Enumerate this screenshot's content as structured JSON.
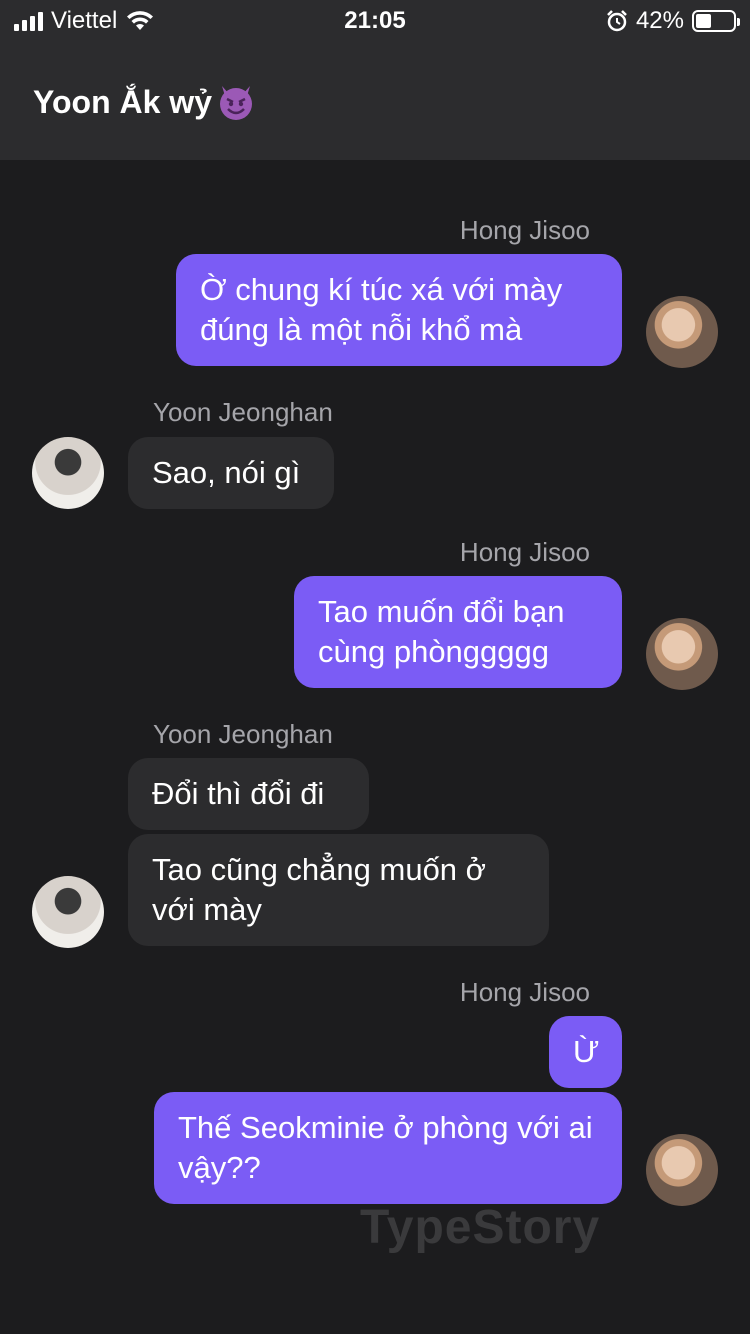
{
  "status_bar": {
    "carrier": "Viettel",
    "time": "21:05",
    "battery": "42%",
    "battery_level": 0.42
  },
  "header": {
    "title": "Yoon Ắk wỷ",
    "icon": "devil-emoji-icon"
  },
  "messages": [
    {
      "sender": "Hong Jisoo",
      "text": "Ờ chung kí túc xá với mày đúng là một nỗi khổ mà"
    },
    {
      "sender": "Yoon Jeonghan",
      "text": "Sao, nói gì"
    },
    {
      "sender": "Hong Jisoo",
      "text": "Tao muốn đổi bạn cùng phònggggg"
    },
    {
      "sender": "Yoon Jeonghan",
      "text": "Đổi thì đổi đi"
    },
    {
      "sender": "Yoon Jeonghan",
      "text": "Tao cũng chẳng muốn ở với mày"
    },
    {
      "sender": "Hong Jisoo",
      "text": "Ừ"
    },
    {
      "sender": "Hong Jisoo",
      "text": "Thế Seokminie ở phòng với ai vậy??"
    }
  ],
  "watermark": "TypeStory",
  "colors": {
    "outgoing": "#7b5cf5",
    "incoming": "#2c2c2e",
    "background": "#1c1c1e"
  }
}
